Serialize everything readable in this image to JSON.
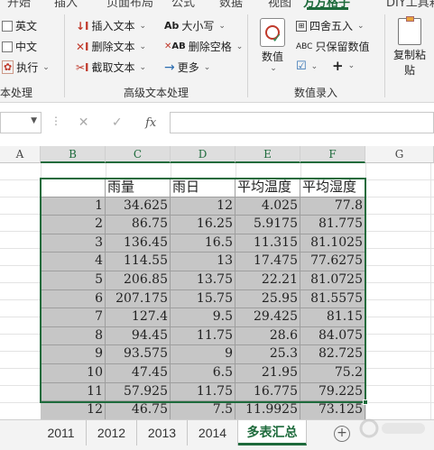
{
  "ribbon": {
    "tabs": [
      "开始",
      "插入",
      "页面布局",
      "公式",
      "数据",
      "视图",
      "方方格子",
      "DIY工具箱"
    ],
    "active_tab": "方方格子",
    "left_group": {
      "items": [
        "英文",
        "中文",
        "执行"
      ],
      "group_label": "本处理"
    },
    "text_group": {
      "col1": [
        "插入文本",
        "删除文本",
        "截取文本"
      ],
      "col2": [
        "大小写",
        "删除空格",
        "更多"
      ],
      "group_label": "高级文本处理"
    },
    "number_group": {
      "big_button": "数值",
      "items": [
        "四舍五入",
        "只保留数值"
      ],
      "group_label": "数值录入"
    },
    "copy_group": {
      "big_button_line1": "复制粘",
      "big_button_line2": "贴"
    }
  },
  "formula_bar": {
    "fx_label": "fx",
    "cancel": "✕",
    "enter": "✓"
  },
  "columns": [
    "A",
    "B",
    "C",
    "D",
    "E",
    "F",
    "G"
  ],
  "selected_columns": [
    "B",
    "C",
    "D",
    "E",
    "F"
  ],
  "table": {
    "headers": [
      "",
      "雨量",
      "雨日",
      "平均温度",
      "平均湿度"
    ],
    "rows": [
      [
        "1",
        "34.625",
        "12",
        "4.025",
        "77.8"
      ],
      [
        "2",
        "86.75",
        "16.25",
        "5.9175",
        "81.775"
      ],
      [
        "3",
        "136.45",
        "16.5",
        "11.315",
        "81.1025"
      ],
      [
        "4",
        "114.55",
        "13",
        "17.475",
        "77.6275"
      ],
      [
        "5",
        "206.85",
        "13.75",
        "22.21",
        "81.0725"
      ],
      [
        "6",
        "207.175",
        "15.75",
        "25.95",
        "81.5575"
      ],
      [
        "7",
        "127.4",
        "9.5",
        "29.425",
        "81.15"
      ],
      [
        "8",
        "94.45",
        "11.75",
        "28.6",
        "84.075"
      ],
      [
        "9",
        "93.575",
        "9",
        "25.3",
        "82.725"
      ],
      [
        "10",
        "47.45",
        "6.5",
        "21.95",
        "75.2"
      ],
      [
        "11",
        "57.925",
        "11.75",
        "16.775",
        "79.225"
      ],
      [
        "12",
        "46.75",
        "7.5",
        "11.9925",
        "73.125"
      ]
    ]
  },
  "sheet_tabs": [
    "2011",
    "2012",
    "2013",
    "2014",
    "多表汇总"
  ],
  "active_sheet": "多表汇总",
  "colors": {
    "accent": "#1e6b3c",
    "selection_fill": "#c6c6c6"
  }
}
